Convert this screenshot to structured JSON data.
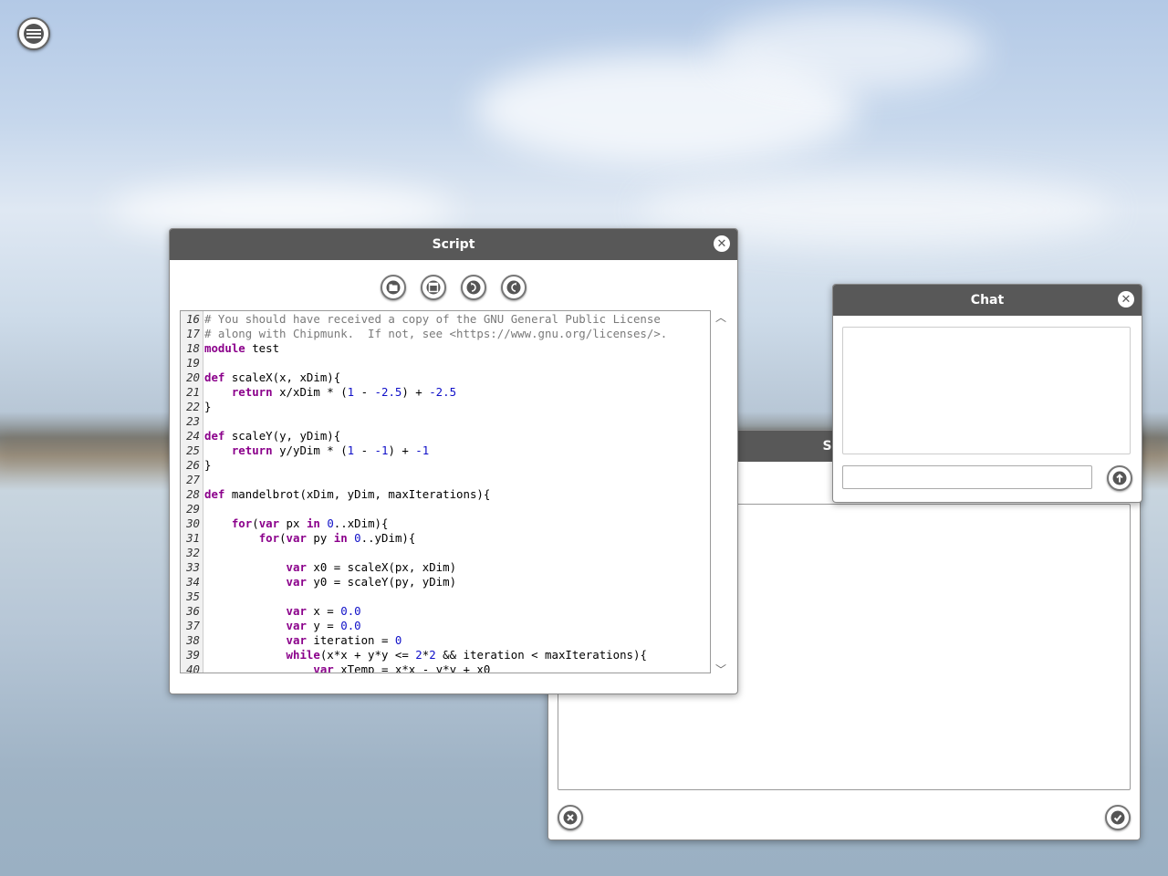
{
  "menu": {
    "icon": "hamburger-menu-icon"
  },
  "settings": {
    "title": "Sett",
    "cancel_icon": "x-icon",
    "ok_icon": "check-icon"
  },
  "script": {
    "title": "Script",
    "toolbar": [
      {
        "icon": "open-folder-icon"
      },
      {
        "icon": "save-window-icon"
      },
      {
        "icon": "redo-icon"
      },
      {
        "icon": "undo-icon"
      }
    ],
    "lines": [
      {
        "n": "16",
        "t": "# You should have received a copy of the GNU General Public License"
      },
      {
        "n": "17",
        "t": "# along with Chipmunk.  If not, see <https://www.gnu.org/licenses/>."
      },
      {
        "n": "18",
        "t": "module test"
      },
      {
        "n": "19",
        "t": ""
      },
      {
        "n": "20",
        "t": "def scaleX(x, xDim){"
      },
      {
        "n": "21",
        "t": "    return x/xDim * (1 - -2.5) + -2.5"
      },
      {
        "n": "22",
        "t": "}"
      },
      {
        "n": "23",
        "t": ""
      },
      {
        "n": "24",
        "t": "def scaleY(y, yDim){"
      },
      {
        "n": "25",
        "t": "    return y/yDim * (1 - -1) + -1"
      },
      {
        "n": "26",
        "t": "}"
      },
      {
        "n": "27",
        "t": ""
      },
      {
        "n": "28",
        "t": "def mandelbrot(xDim, yDim, maxIterations){"
      },
      {
        "n": "29",
        "t": ""
      },
      {
        "n": "30",
        "t": "    for(var px in 0..xDim){"
      },
      {
        "n": "31",
        "t": "        for(var py in 0..yDim){"
      },
      {
        "n": "32",
        "t": ""
      },
      {
        "n": "33",
        "t": "            var x0 = scaleX(px, xDim)"
      },
      {
        "n": "34",
        "t": "            var y0 = scaleY(py, yDim)"
      },
      {
        "n": "35",
        "t": ""
      },
      {
        "n": "36",
        "t": "            var x = 0.0"
      },
      {
        "n": "37",
        "t": "            var y = 0.0"
      },
      {
        "n": "38",
        "t": "            var iteration = 0"
      },
      {
        "n": "39",
        "t": "            while(x*x + y*y <= 2*2 && iteration < maxIterations){"
      },
      {
        "n": "40",
        "t": "                var xTemp = x*x - y*y + x0"
      }
    ]
  },
  "chat": {
    "title": "Chat",
    "input_value": "",
    "send_icon": "arrow-up-icon"
  }
}
